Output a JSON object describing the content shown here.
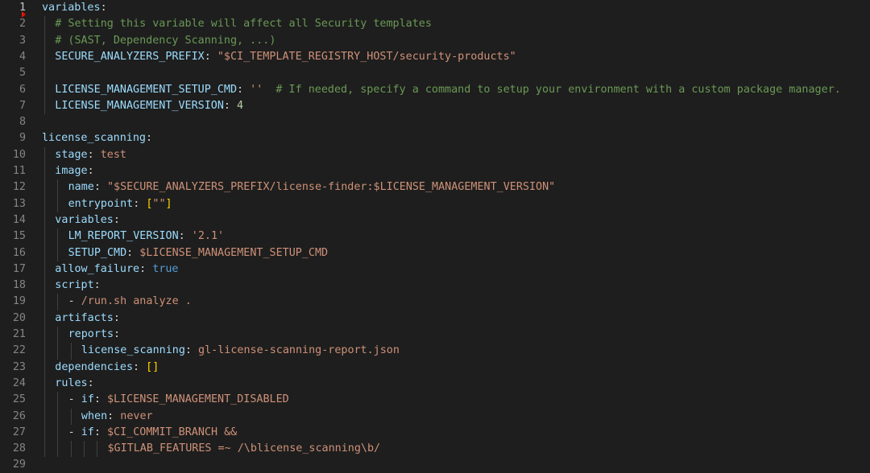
{
  "editor": {
    "lines": [
      {
        "num": "1",
        "tokens": [
          {
            "t": "k",
            "v": "variables"
          },
          {
            "t": "p",
            "v": ":"
          }
        ]
      },
      {
        "num": "2",
        "tokens": [
          {
            "t": "c",
            "v": "# Setting this variable will affect all Security templates"
          }
        ]
      },
      {
        "num": "3",
        "tokens": [
          {
            "t": "c",
            "v": "# (SAST, Dependency Scanning, ...)"
          }
        ]
      },
      {
        "num": "4",
        "tokens": [
          {
            "t": "k",
            "v": "SECURE_ANALYZERS_PREFIX"
          },
          {
            "t": "p",
            "v": ": "
          },
          {
            "t": "s",
            "v": "\"$CI_TEMPLATE_REGISTRY_HOST/security-products\""
          }
        ]
      },
      {
        "num": "5",
        "tokens": []
      },
      {
        "num": "6",
        "tokens": [
          {
            "t": "k",
            "v": "LICENSE_MANAGEMENT_SETUP_CMD"
          },
          {
            "t": "p",
            "v": ": "
          },
          {
            "t": "s",
            "v": "''"
          },
          {
            "t": "p",
            "v": "  "
          },
          {
            "t": "c",
            "v": "# If needed, specify a command to setup your environment with a custom package manager."
          }
        ]
      },
      {
        "num": "7",
        "tokens": [
          {
            "t": "k",
            "v": "LICENSE_MANAGEMENT_VERSION"
          },
          {
            "t": "p",
            "v": ": "
          },
          {
            "t": "n",
            "v": "4"
          }
        ]
      },
      {
        "num": "8",
        "tokens": []
      },
      {
        "num": "9",
        "tokens": [
          {
            "t": "k",
            "v": "license_scanning"
          },
          {
            "t": "p",
            "v": ":"
          }
        ]
      },
      {
        "num": "10",
        "tokens": [
          {
            "t": "k",
            "v": "stage"
          },
          {
            "t": "p",
            "v": ": "
          },
          {
            "t": "s",
            "v": "test"
          }
        ]
      },
      {
        "num": "11",
        "tokens": [
          {
            "t": "k",
            "v": "image"
          },
          {
            "t": "p",
            "v": ":"
          }
        ]
      },
      {
        "num": "12",
        "tokens": [
          {
            "t": "k",
            "v": "name"
          },
          {
            "t": "p",
            "v": ": "
          },
          {
            "t": "s",
            "v": "\"$SECURE_ANALYZERS_PREFIX/license-finder:$LICENSE_MANAGEMENT_VERSION\""
          }
        ]
      },
      {
        "num": "13",
        "tokens": [
          {
            "t": "k",
            "v": "entrypoint"
          },
          {
            "t": "p",
            "v": ": "
          },
          {
            "t": "br",
            "v": "["
          },
          {
            "t": "s",
            "v": "\"\""
          },
          {
            "t": "br",
            "v": "]"
          }
        ]
      },
      {
        "num": "14",
        "tokens": [
          {
            "t": "k",
            "v": "variables"
          },
          {
            "t": "p",
            "v": ":"
          }
        ]
      },
      {
        "num": "15",
        "tokens": [
          {
            "t": "k",
            "v": "LM_REPORT_VERSION"
          },
          {
            "t": "p",
            "v": ": "
          },
          {
            "t": "s",
            "v": "'2.1'"
          }
        ]
      },
      {
        "num": "16",
        "tokens": [
          {
            "t": "k",
            "v": "SETUP_CMD"
          },
          {
            "t": "p",
            "v": ": "
          },
          {
            "t": "s",
            "v": "$LICENSE_MANAGEMENT_SETUP_CMD"
          }
        ]
      },
      {
        "num": "17",
        "tokens": [
          {
            "t": "k",
            "v": "allow_failure"
          },
          {
            "t": "p",
            "v": ": "
          },
          {
            "t": "b",
            "v": "true"
          }
        ]
      },
      {
        "num": "18",
        "tokens": [
          {
            "t": "k",
            "v": "script"
          },
          {
            "t": "p",
            "v": ":"
          }
        ]
      },
      {
        "num": "19",
        "tokens": [
          {
            "t": "p",
            "v": "- "
          },
          {
            "t": "s",
            "v": "/run.sh analyze ."
          }
        ]
      },
      {
        "num": "20",
        "tokens": [
          {
            "t": "k",
            "v": "artifacts"
          },
          {
            "t": "p",
            "v": ":"
          }
        ]
      },
      {
        "num": "21",
        "tokens": [
          {
            "t": "k",
            "v": "reports"
          },
          {
            "t": "p",
            "v": ":"
          }
        ]
      },
      {
        "num": "22",
        "tokens": [
          {
            "t": "k",
            "v": "license_scanning"
          },
          {
            "t": "p",
            "v": ": "
          },
          {
            "t": "s",
            "v": "gl-license-scanning-report.json"
          }
        ]
      },
      {
        "num": "23",
        "tokens": [
          {
            "t": "k",
            "v": "dependencies"
          },
          {
            "t": "p",
            "v": ": "
          },
          {
            "t": "br",
            "v": "[]"
          }
        ]
      },
      {
        "num": "24",
        "tokens": [
          {
            "t": "k",
            "v": "rules"
          },
          {
            "t": "p",
            "v": ":"
          }
        ]
      },
      {
        "num": "25",
        "tokens": [
          {
            "t": "p",
            "v": "- "
          },
          {
            "t": "k",
            "v": "if"
          },
          {
            "t": "p",
            "v": ": "
          },
          {
            "t": "s",
            "v": "$LICENSE_MANAGEMENT_DISABLED"
          }
        ]
      },
      {
        "num": "26",
        "tokens": [
          {
            "t": "k",
            "v": "when"
          },
          {
            "t": "p",
            "v": ": "
          },
          {
            "t": "s",
            "v": "never"
          }
        ]
      },
      {
        "num": "27",
        "tokens": [
          {
            "t": "p",
            "v": "- "
          },
          {
            "t": "k",
            "v": "if"
          },
          {
            "t": "p",
            "v": ": "
          },
          {
            "t": "s",
            "v": "$CI_COMMIT_BRANCH &&"
          }
        ]
      },
      {
        "num": "28",
        "tokens": [
          {
            "t": "s",
            "v": "$GITLAB_FEATURES =~ /\\blicense_scanning\\b/"
          }
        ]
      },
      {
        "num": "29",
        "tokens": []
      }
    ]
  }
}
